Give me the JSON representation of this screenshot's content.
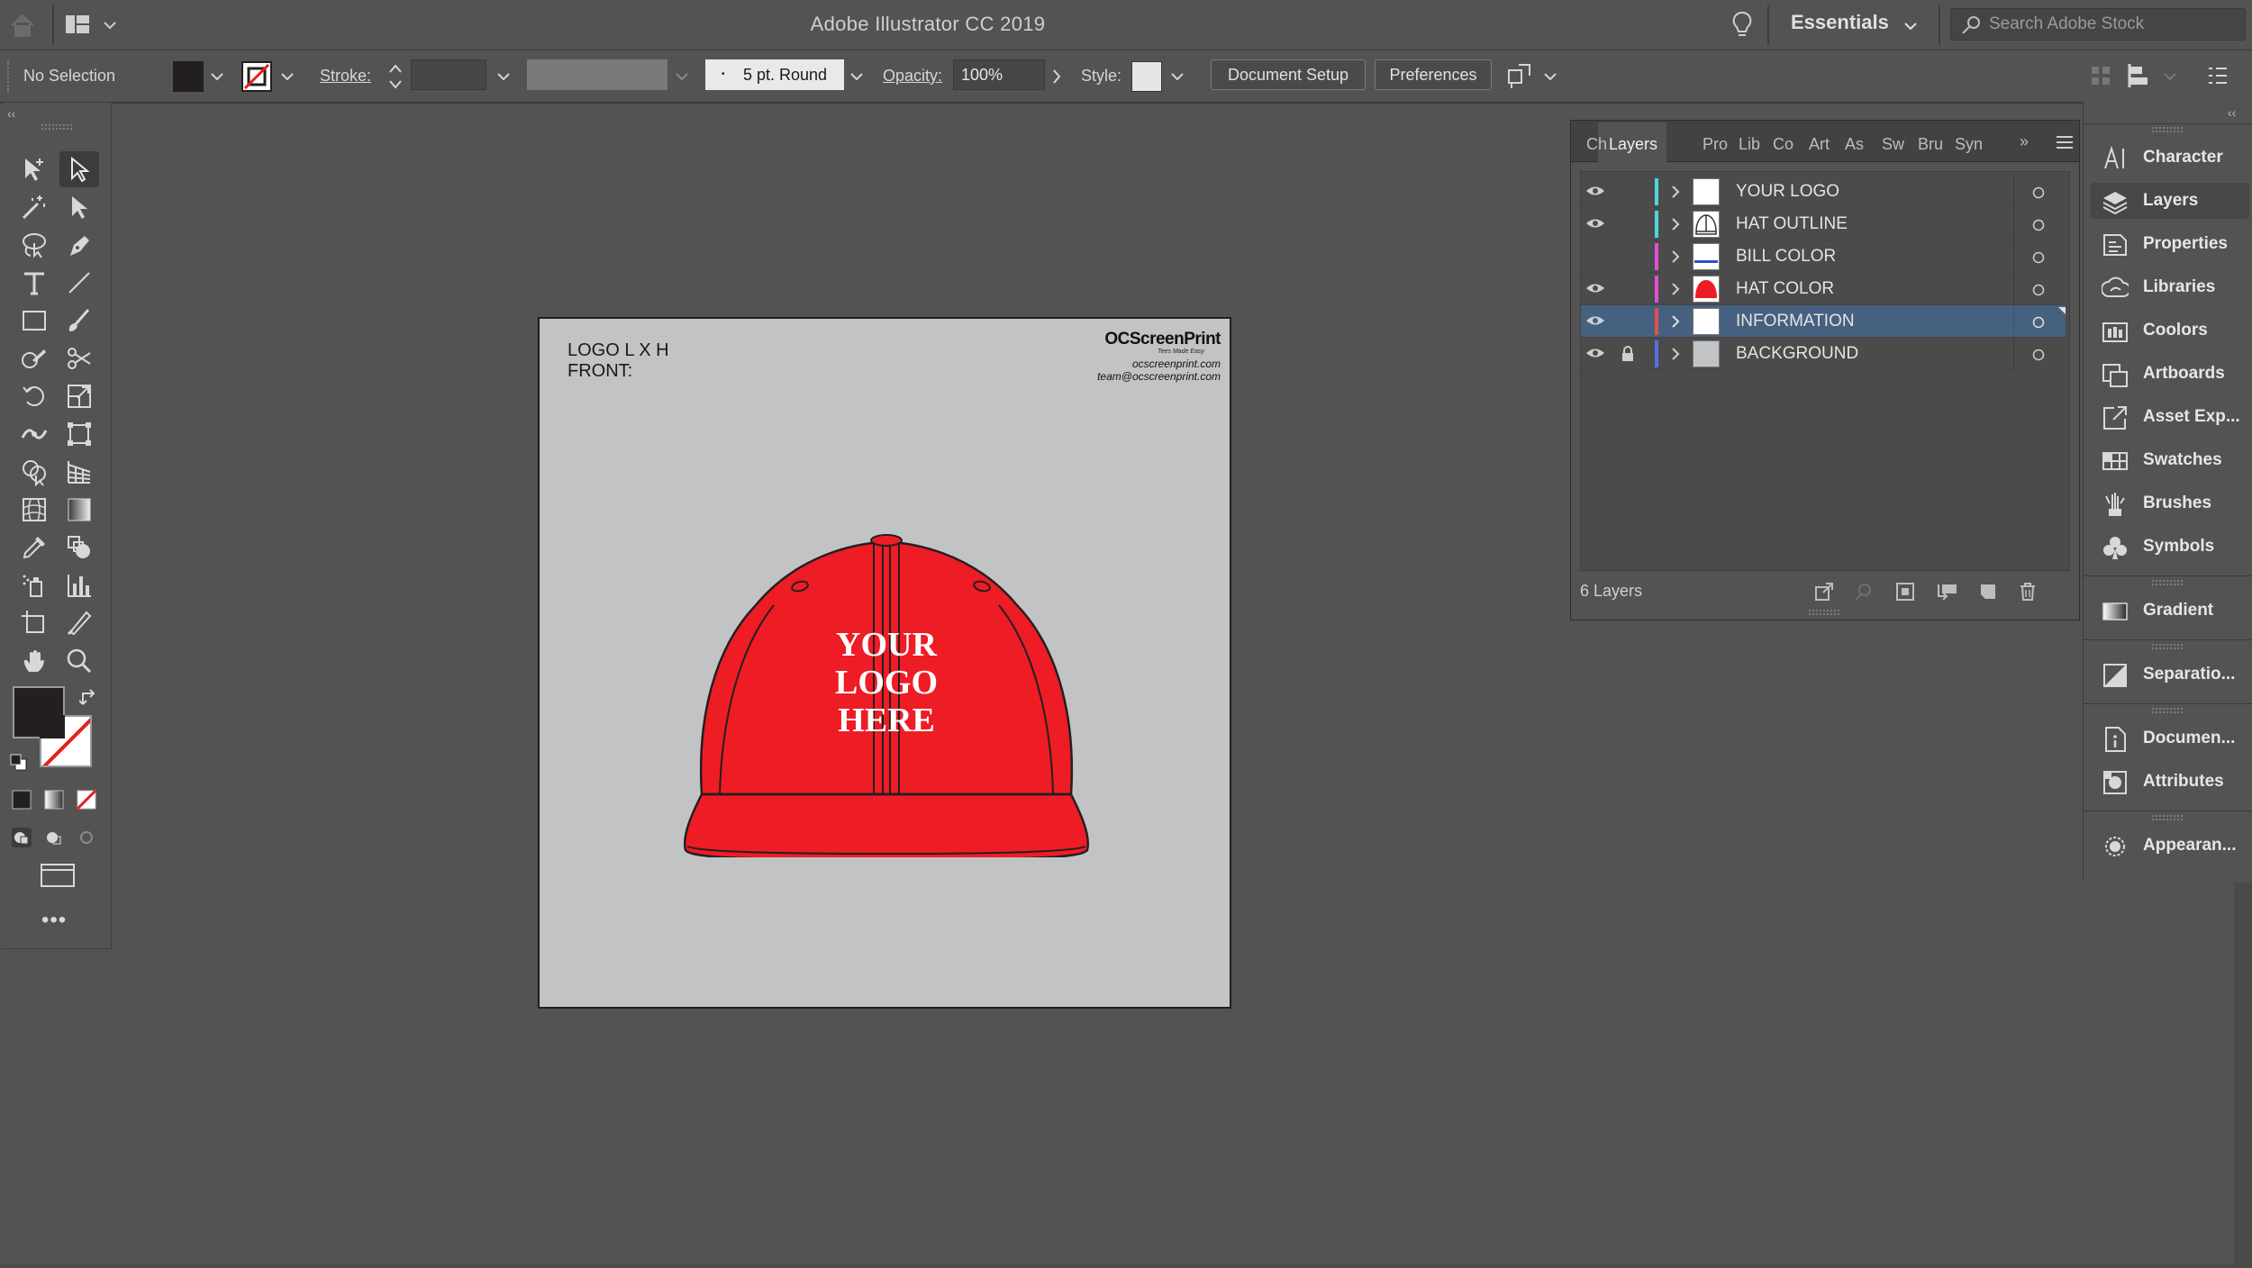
{
  "app": {
    "title": "Adobe Illustrator CC 2019",
    "workspace": "Essentials",
    "search_placeholder": "Search Adobe Stock"
  },
  "control_bar": {
    "selection": "No Selection",
    "stroke_label": "Stroke:",
    "brush": "5 pt. Round",
    "opacity_label": "Opacity:",
    "opacity_value": "100%",
    "style_label": "Style:",
    "document_setup": "Document Setup",
    "preferences": "Preferences"
  },
  "artboard": {
    "spec_line1": "LOGO L X H",
    "spec_line2": "FRONT:",
    "brand": "OCScreenPrint",
    "brand_tagline": "Tees Made Easy",
    "website": "ocscreenprint.com",
    "email": "team@ocscreenprint.com",
    "logo_text": [
      "YOUR",
      "LOGO",
      "HERE"
    ],
    "hat_color": "#ee1c25"
  },
  "layers_panel": {
    "tabs": [
      "Ch",
      "Layers",
      "Pro",
      "Lib",
      "Co",
      "Art",
      "As",
      "Sw",
      "Bru",
      "Syn"
    ],
    "active_tab": "Layers",
    "layers": [
      {
        "name": "YOUR LOGO",
        "visible": true,
        "locked": false,
        "color": "#4fd6e0",
        "thumb": "white"
      },
      {
        "name": "HAT OUTLINE",
        "visible": true,
        "locked": false,
        "color": "#4fd6e0",
        "thumb": "outline"
      },
      {
        "name": "BILL COLOR",
        "visible": false,
        "locked": false,
        "color": "#e04fd8",
        "thumb": "bill"
      },
      {
        "name": "HAT COLOR",
        "visible": true,
        "locked": false,
        "color": "#e04fd8",
        "thumb": "red"
      },
      {
        "name": "INFORMATION",
        "visible": true,
        "locked": false,
        "color": "#e0504f",
        "thumb": "white",
        "selected": true
      },
      {
        "name": "BACKGROUND",
        "visible": true,
        "locked": true,
        "color": "#5a6fe0",
        "thumb": "gray"
      }
    ],
    "count": "6 Layers"
  },
  "dock": {
    "items": [
      {
        "label": "Character",
        "icon": "character-icon"
      },
      {
        "label": "Layers",
        "icon": "layers-icon",
        "active": true
      },
      {
        "label": "Properties",
        "icon": "properties-icon"
      },
      {
        "label": "Libraries",
        "icon": "libraries-icon"
      },
      {
        "label": "Coolors",
        "icon": "coolors-icon"
      },
      {
        "label": "Artboards",
        "icon": "artboards-icon"
      },
      {
        "label": "Asset Exp...",
        "icon": "asset-export-icon"
      },
      {
        "label": "Swatches",
        "icon": "swatches-icon"
      },
      {
        "label": "Brushes",
        "icon": "brushes-icon"
      },
      {
        "label": "Symbols",
        "icon": "symbols-icon"
      },
      {
        "label": "Gradient",
        "icon": "gradient-icon"
      },
      {
        "label": "Separatio...",
        "icon": "separations-icon"
      },
      {
        "label": "Documen...",
        "icon": "document-info-icon"
      },
      {
        "label": "Attributes",
        "icon": "attributes-icon"
      },
      {
        "label": "Appearan...",
        "icon": "appearance-icon"
      }
    ]
  }
}
